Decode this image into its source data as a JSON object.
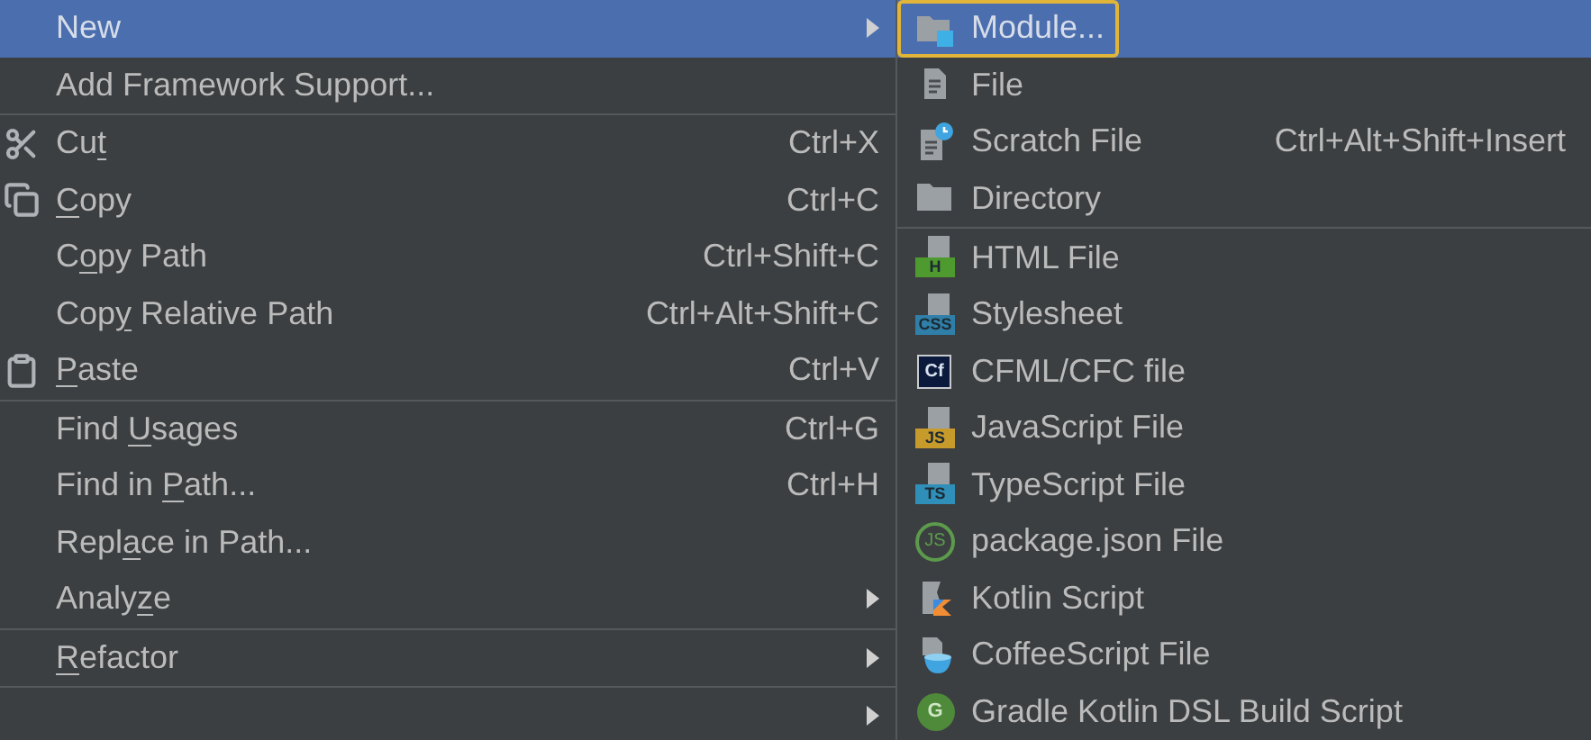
{
  "context_menu": {
    "items": [
      {
        "kind": "plain",
        "label": [
          {
            "text": "New"
          }
        ],
        "submenu": true,
        "selected": true
      },
      {
        "kind": "plain",
        "label": [
          {
            "text": "Add Framework Support..."
          }
        ],
        "selected": false
      },
      {
        "kind": "separator"
      },
      {
        "kind": "cut",
        "label": [
          {
            "text": "Cu"
          },
          {
            "text": "t",
            "underline": true
          }
        ],
        "shortcut": "Ctrl+X",
        "selected": false
      },
      {
        "kind": "copy",
        "label": [
          {
            "text": "C",
            "underline": true
          },
          {
            "text": "opy"
          }
        ],
        "shortcut": "Ctrl+C",
        "selected": false
      },
      {
        "kind": "plain",
        "label": [
          {
            "text": "C"
          },
          {
            "text": "o",
            "underline": true
          },
          {
            "text": "py Path"
          }
        ],
        "shortcut": "Ctrl+Shift+C",
        "selected": false
      },
      {
        "kind": "plain",
        "label": [
          {
            "text": "Cop"
          },
          {
            "text": "y",
            "underline": true
          },
          {
            "text": " Relative Path"
          }
        ],
        "shortcut": "Ctrl+Alt+Shift+C",
        "selected": false
      },
      {
        "kind": "paste",
        "label": [
          {
            "text": "P",
            "underline": true
          },
          {
            "text": "aste"
          }
        ],
        "shortcut": "Ctrl+V",
        "selected": false
      },
      {
        "kind": "separator"
      },
      {
        "kind": "plain",
        "label": [
          {
            "text": "Find "
          },
          {
            "text": "U",
            "underline": true
          },
          {
            "text": "sages"
          }
        ],
        "shortcut": "Ctrl+G",
        "selected": false
      },
      {
        "kind": "plain",
        "label": [
          {
            "text": "Find in "
          },
          {
            "text": "P",
            "underline": true
          },
          {
            "text": "ath..."
          }
        ],
        "shortcut": "Ctrl+H",
        "selected": false
      },
      {
        "kind": "plain",
        "label": [
          {
            "text": "Repl"
          },
          {
            "text": "a",
            "underline": true
          },
          {
            "text": "ce in Path..."
          }
        ],
        "selected": false
      },
      {
        "kind": "plain",
        "label": [
          {
            "text": "Analy"
          },
          {
            "text": "z",
            "underline": true
          },
          {
            "text": "e"
          }
        ],
        "submenu": true,
        "selected": false
      },
      {
        "kind": "separator"
      },
      {
        "kind": "plain",
        "label": [
          {
            "text": "R",
            "underline": true
          },
          {
            "text": "efactor"
          }
        ],
        "submenu": true,
        "selected": false
      },
      {
        "kind": "separator"
      },
      {
        "kind": "plain",
        "submenu": true,
        "selected": false
      }
    ]
  },
  "new_submenu": {
    "items": [
      {
        "kind": "module",
        "label": "Module...",
        "selected": true,
        "focused": true
      },
      {
        "kind": "file",
        "label": "File",
        "selected": false
      },
      {
        "kind": "scratch",
        "label": "Scratch File",
        "shortcut": "Ctrl+Alt+Shift+Insert",
        "selected": false
      },
      {
        "kind": "folder",
        "label": "Directory",
        "selected": false
      },
      {
        "kind": "separator"
      },
      {
        "kind": "html",
        "icon_text": "H",
        "label": "HTML File",
        "selected": false
      },
      {
        "kind": "css",
        "icon_text": "CSS",
        "label": "Stylesheet",
        "selected": false
      },
      {
        "kind": "cfml",
        "icon_text": "Cf",
        "label": "CFML/CFC file",
        "selected": false
      },
      {
        "kind": "js",
        "icon_text": "JS",
        "label": "JavaScript File",
        "selected": false
      },
      {
        "kind": "ts",
        "icon_text": "TS",
        "label": "TypeScript File",
        "selected": false
      },
      {
        "kind": "node",
        "icon_text": "JS",
        "label": "package.json File",
        "selected": false
      },
      {
        "kind": "kotlin",
        "label": "Kotlin Script",
        "selected": false
      },
      {
        "kind": "coffee",
        "label": "CoffeeScript File",
        "selected": false
      },
      {
        "kind": "gradle",
        "icon_text": "G",
        "label": "Gradle Kotlin DSL Build Script",
        "selected": false
      }
    ]
  }
}
